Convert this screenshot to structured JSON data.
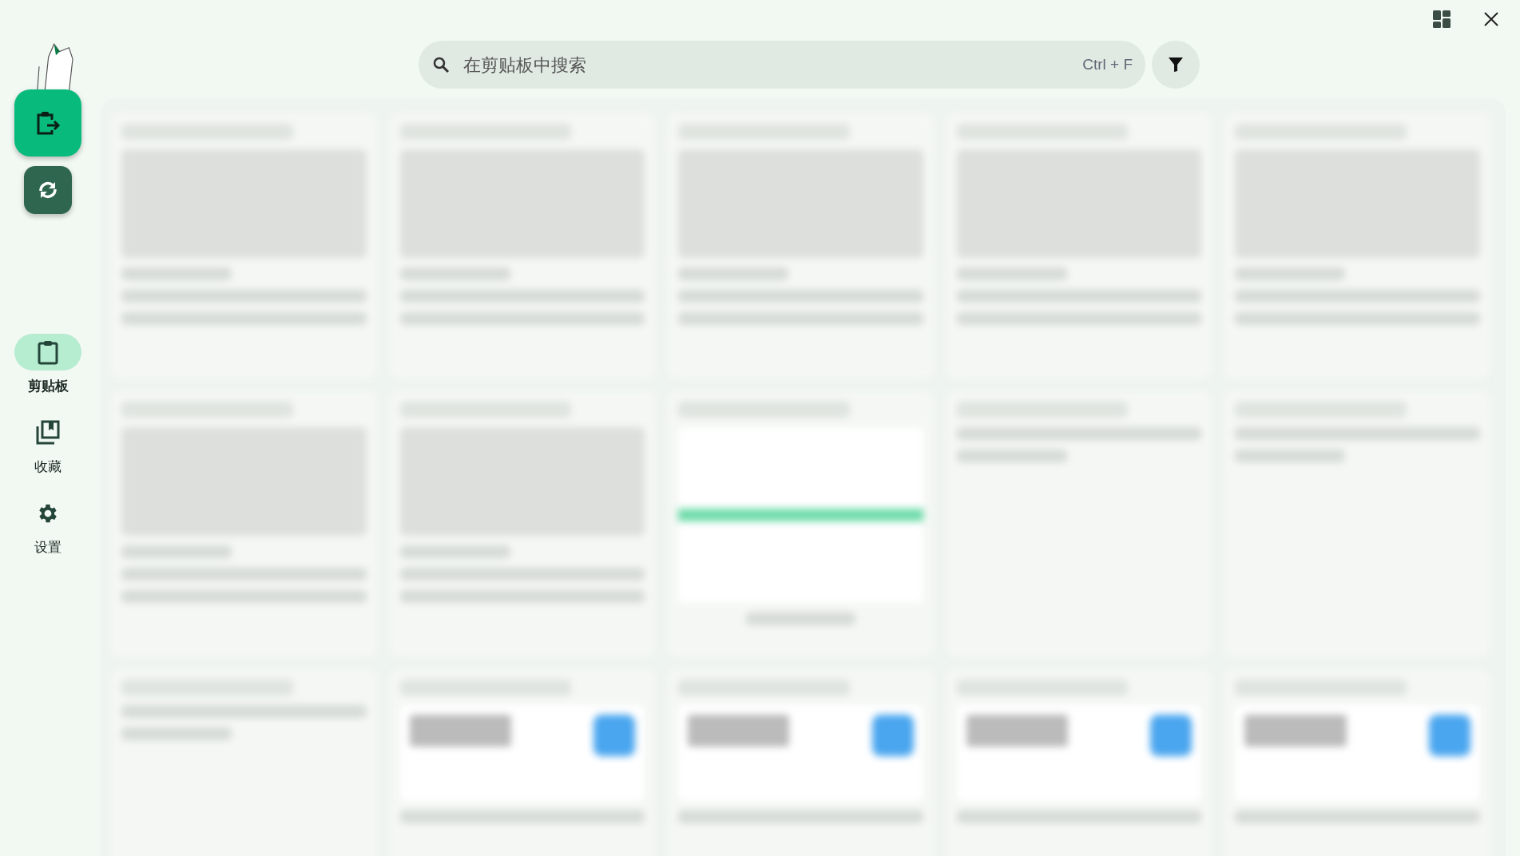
{
  "actions": [
    {
      "kind": "paste"
    },
    {
      "kind": "sync"
    }
  ],
  "nav": [
    {
      "kind": "clipboard",
      "label": "剪贴板",
      "selected": true
    },
    {
      "kind": "favorites",
      "label": "收藏",
      "selected": false
    },
    {
      "kind": "settings",
      "label": "设置",
      "selected": false
    }
  ],
  "search": {
    "placeholder": "在剪贴板中搜索",
    "shortcut": "Ctrl + F"
  },
  "cards": [
    {
      "kind": "image"
    },
    {
      "kind": "image"
    },
    {
      "kind": "image"
    },
    {
      "kind": "image"
    },
    {
      "kind": "image"
    },
    {
      "kind": "image"
    },
    {
      "kind": "image"
    },
    {
      "kind": "screenshot"
    },
    {
      "kind": "text"
    },
    {
      "kind": "text"
    },
    {
      "kind": "text"
    },
    {
      "kind": "link"
    },
    {
      "kind": "link"
    },
    {
      "kind": "link"
    },
    {
      "kind": "link"
    }
  ]
}
